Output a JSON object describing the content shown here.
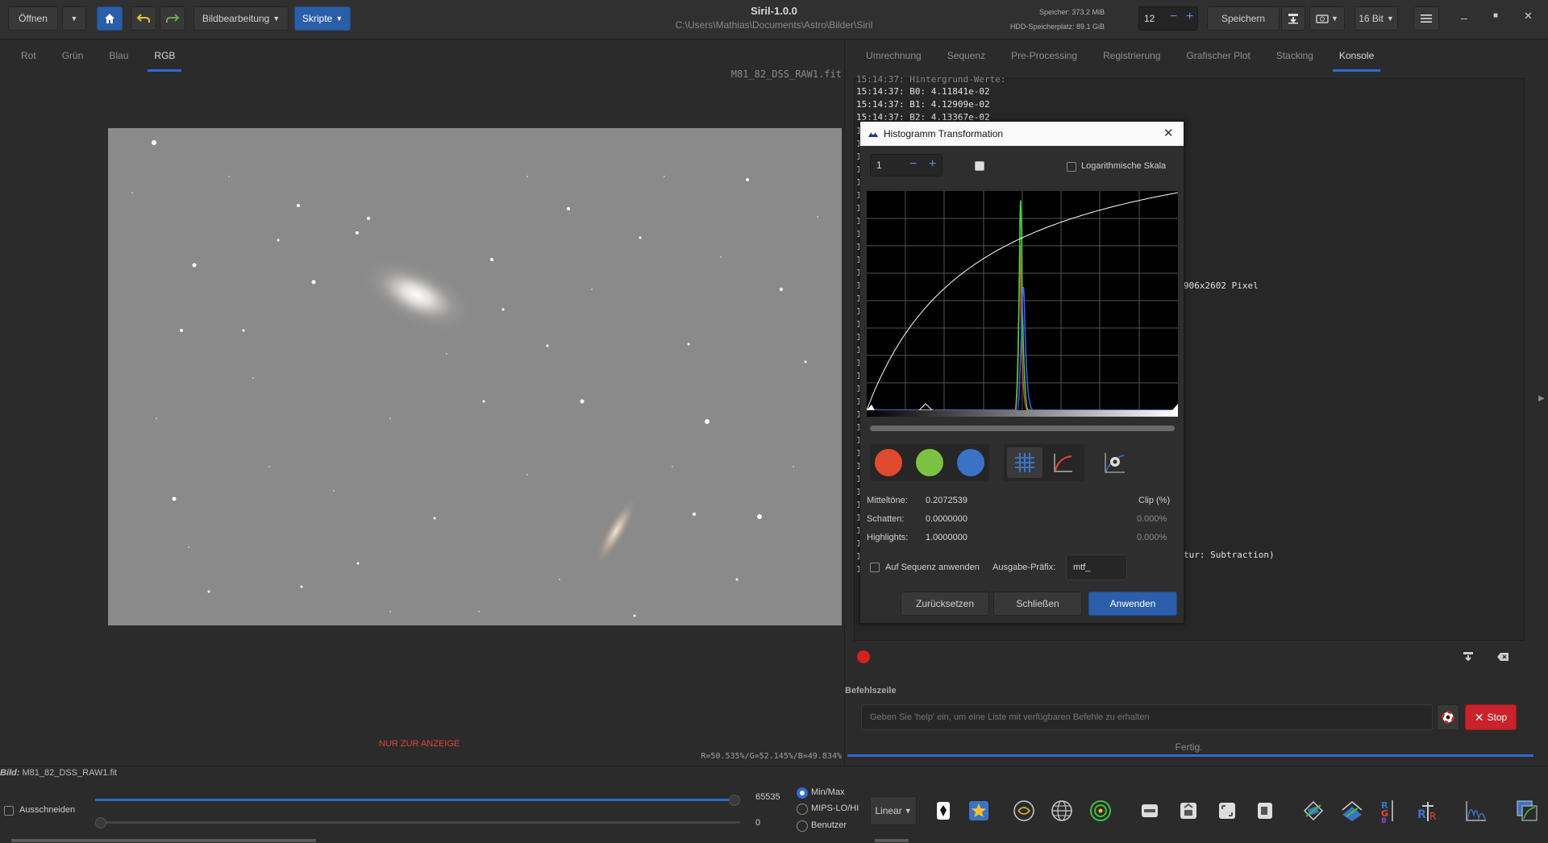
{
  "header": {
    "open_label": "Öffnen",
    "image_processing_label": "Bildbearbeitung",
    "scripts_label": "Skripte",
    "app_title": "Siril-1.0.0",
    "working_dir": "C:\\Users\\Mathias\\Documents\\Astro\\Bilder\\Siril",
    "memory_label": "Speicher: 373.2 MiB",
    "disk_label": "HDD-Speicherplatz: 89.1 GiB",
    "threads_value": "12",
    "save_label": "Speichern",
    "bitdepth_label": "16 Bit"
  },
  "channel_tabs": [
    "Rot",
    "Grün",
    "Blau",
    "RGB"
  ],
  "image": {
    "filename_overlay": "M81_82_DSS_RAW1.fit",
    "display_only_label": "NUR ZUR ANZEIGE",
    "pixel_values": "R=50.535%/G=52.145%/B=49.834%",
    "status_label": "Bild:",
    "status_filename": "M81_82_DSS_RAW1.fit"
  },
  "right_tabs": [
    "Umrechnung",
    "Sequenz",
    "Pre-Processing",
    "Registrierung",
    "Grafischer Plot",
    "Stacking",
    "Konsole"
  ],
  "console": {
    "partial_top_line": "15:14:37: Hintergrund-Werte:",
    "lines": [
      "15:14:37: B0: 4.11841e-02",
      "15:14:37: B1: 4.12909e-02",
      "15:14:37: B2: 4.13367e-02"
    ],
    "fragment_pixels": "906x2602 Pixel",
    "fragment_subtraction": "tur: Subtraction)",
    "gutter_char": "1"
  },
  "command": {
    "section_label": "Befehlszeile",
    "placeholder": "Geben Sie 'help' ein, um eine Liste mit verfügbaren Befehle zu erhalten",
    "stop_label": "Stop",
    "status": "Fertig."
  },
  "dialog": {
    "title": "Histogramm Transformation",
    "zoom_value": "1",
    "log_scale_label": "Logarithmische Skala",
    "midtones_label": "Mitteltöne:",
    "midtones_value": "0.2072539",
    "shadows_label": "Schatten:",
    "shadows_value": "0.0000000",
    "highlights_label": "Highlights:",
    "highlights_value": "1.0000000",
    "clip_header": "Clip (%)",
    "shadows_clip": "0.000%",
    "highlights_clip": "0.000%",
    "apply_sequence_label": "Auf Sequenz anwenden",
    "prefix_label": "Ausgabe-Präfix:",
    "prefix_value": "mtf_",
    "reset_label": "Zurücksetzen",
    "close_label": "Schließen",
    "apply_label": "Anwenden"
  },
  "bottom": {
    "crop_label": "Ausschneiden",
    "max_value": "65535",
    "min_value": "0",
    "max_slider": 1.0,
    "min_slider": 0.0,
    "scale_options": [
      "Min/Max",
      "MIPS-LO/HI",
      "Benutzer"
    ],
    "selected_scale": "Min/Max",
    "stretch_label": "Linear"
  },
  "colors": {
    "accent": "#2f6bd1",
    "stop_red": "#c8222a",
    "display_only_red": "#e0443a",
    "channel_red": "#e04a2f",
    "channel_green": "#7cc242",
    "channel_blue": "#3a73c6"
  },
  "icons": [
    "dropdown-icon",
    "home-icon",
    "undo-icon",
    "redo-icon",
    "save-icon",
    "snapshot-icon",
    "menu-icon",
    "minimize-icon",
    "maximize-icon",
    "close-icon",
    "grid-icon",
    "curve-icon",
    "settings-icon",
    "record-icon",
    "clear-icon",
    "lifebuoy-icon"
  ]
}
